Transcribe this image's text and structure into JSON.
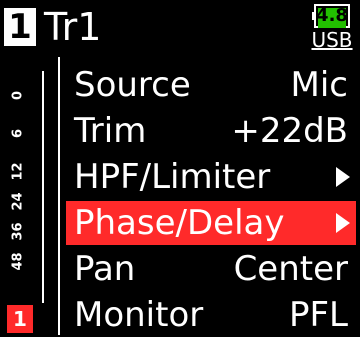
{
  "header": {
    "track_badge": "1",
    "track_name": "Tr1",
    "battery_level": "4.8",
    "power_source": "USB"
  },
  "meter": {
    "scale_labels": [
      "0",
      "6",
      "12",
      "24",
      "36",
      "48"
    ],
    "active_track": "1"
  },
  "menu": {
    "items": [
      {
        "label": "Source",
        "value": "Mic"
      },
      {
        "label": "Trim",
        "value": "+22dB"
      },
      {
        "label": "HPF/Limiter",
        "value": ""
      },
      {
        "label": "Phase/Delay",
        "value": ""
      },
      {
        "label": "Pan",
        "value": "Center"
      },
      {
        "label": "Monitor",
        "value": "PFL"
      }
    ],
    "selected_index": 3
  },
  "colors": {
    "selection": "#ff2a2a",
    "battery": "#22c000",
    "background": "#000000",
    "text": "#ffffff"
  }
}
